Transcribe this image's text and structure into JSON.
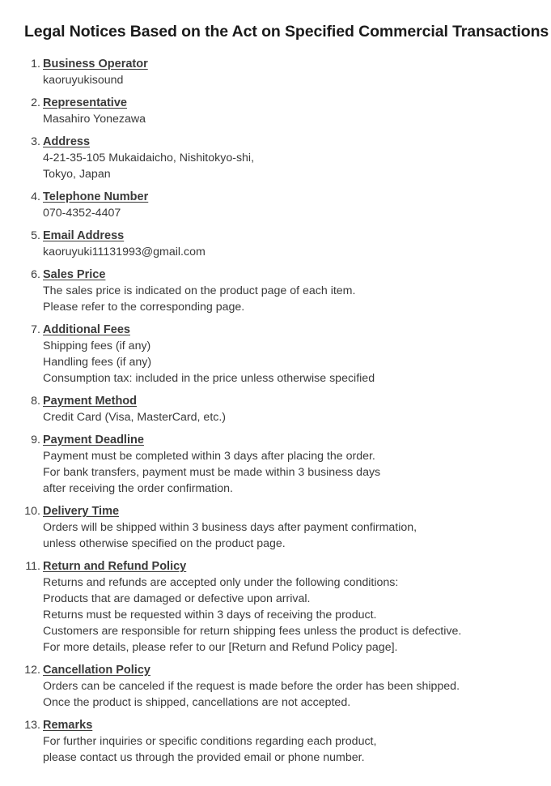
{
  "page": {
    "title": "Legal Notices Based on the Act on Specified Commercial Transactions"
  },
  "items": [
    {
      "number": "1.",
      "heading": "Business Operator",
      "lines": [
        "kaoruyukisound"
      ]
    },
    {
      "number": "2.",
      "heading": "Representative",
      "lines": [
        "Masahiro Yonezawa"
      ]
    },
    {
      "number": "3.",
      "heading": "Address",
      "lines": [
        "4-21-35-105 Mukaidaicho, Nishitokyo-shi,",
        "Tokyo, Japan"
      ]
    },
    {
      "number": "4.",
      "heading": "Telephone Number",
      "lines": [
        "070-4352-4407"
      ]
    },
    {
      "number": "5.",
      "heading": "Email Address",
      "lines": [
        "kaoruyuki11131993@gmail.com"
      ]
    },
    {
      "number": "6.",
      "heading": "Sales Price",
      "lines": [
        "The sales price is indicated on the product page of each item.",
        "Please refer to the corresponding page."
      ]
    },
    {
      "number": "7.",
      "heading": "Additional Fees",
      "lines": [
        "Shipping fees (if any)",
        "Handling fees (if any)",
        "Consumption tax: included in the price unless otherwise specified"
      ]
    },
    {
      "number": "8.",
      "heading": "Payment Method",
      "lines": [
        "Credit Card (Visa, MasterCard, etc.)"
      ]
    },
    {
      "number": "9.",
      "heading": "Payment Deadline",
      "lines": [
        "Payment must be completed within 3 days after placing the order.",
        "For bank transfers, payment must be made within 3 business days",
        "after receiving the order confirmation."
      ]
    },
    {
      "number": "10.",
      "heading": "Delivery Time",
      "lines": [
        "Orders will be shipped within 3 business days after payment confirmation,",
        "unless otherwise specified on the product page."
      ]
    },
    {
      "number": "11.",
      "heading": "Return and Refund Policy",
      "lines": [
        "Returns and refunds are accepted only under the following conditions:",
        "Products that are damaged or defective upon arrival.",
        "Returns must be requested within 3 days of receiving the product.",
        "Customers are responsible for return shipping fees unless the product is defective.",
        "For more details, please refer to our [Return and Refund Policy page]."
      ]
    },
    {
      "number": "12.",
      "heading": "Cancellation Policy",
      "lines": [
        "Orders can be canceled if the request is made before the order has been shipped.",
        "Once the product is shipped, cancellations are not accepted."
      ]
    },
    {
      "number": "13.",
      "heading": "Remarks",
      "lines": [
        "For further inquiries or specific conditions regarding each product,",
        "please contact us through the provided email or phone number."
      ]
    }
  ]
}
